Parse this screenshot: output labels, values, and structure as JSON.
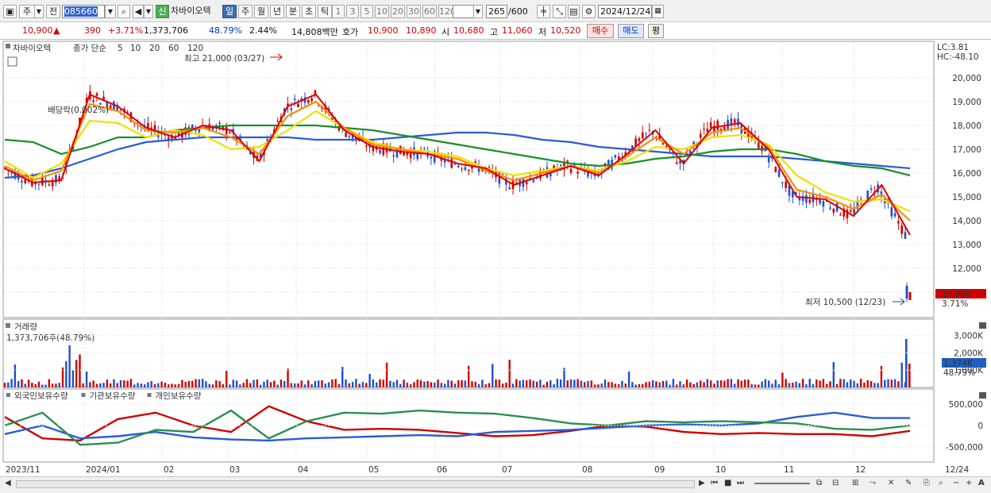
{
  "toolbar": {
    "period_label": "주",
    "name_mode": "전",
    "stock_code": "085660",
    "credit_badge": "신",
    "stock_name": "차바이오텍",
    "timeframes": [
      "일",
      "주",
      "월",
      "년",
      "분",
      "초",
      "틱"
    ],
    "active_timeframe": "일",
    "minute_options": [
      "1",
      "3",
      "5",
      "10",
      "20",
      "30",
      "60",
      "120"
    ],
    "count_value": "265",
    "count_max": "/600",
    "date_value": "2024/12/24"
  },
  "quote": {
    "price": "10,900",
    "change": "390",
    "change_pct": "+3.71%",
    "volume": "1,373,706",
    "volume_ratio": "48.79%",
    "turnover_ratio": "2.44%",
    "trade_value": "14,808백만",
    "bid_label": "호가",
    "bid": "10,900",
    "ask": "10,890",
    "open_label": "시",
    "open": "10,680",
    "high_label": "고",
    "high": "11,060",
    "low_label": "저",
    "low": "10,520",
    "buy_button": "매수",
    "sell_button": "매도",
    "eval_button": "평"
  },
  "price_panel": {
    "title": "차바이오텍",
    "ma_label": "종가 단순",
    "ma_periods": [
      "5",
      "10",
      "20",
      "60",
      "120"
    ],
    "ma_colors": [
      "#e00000",
      "#ff8c00",
      "#f0e000",
      "#1a8f2a",
      "#2a5bd7"
    ],
    "lc_label": "LC:3.81",
    "hc_label": "HC:-48.10",
    "max_annotation": "최고 21,000 (03/27)",
    "min_annotation": "최저 10,500 (12/23)",
    "dividend_annotation": "배당락(0.002%)",
    "current_price_tag": "10,900",
    "current_pct_tag": "3.71%",
    "y_ticks": [
      "20,000",
      "19,000",
      "18,000",
      "17,000",
      "16,000",
      "15,000",
      "14,000",
      "13,000",
      "12,000",
      "11,000"
    ]
  },
  "volume_panel": {
    "title": "거래량",
    "summary": "1,373,706주(48.79%)",
    "y_ticks": [
      "3,000K",
      "2,000K",
      "1,000K"
    ],
    "current_tag": "1,374K",
    "current_pct": "48.79%"
  },
  "holding_panel": {
    "series_labels": [
      "외국인보유수량",
      "기관보유수량",
      "개인보유수량"
    ],
    "series_colors": [
      "#d00000",
      "#2a5bd7",
      "#2a8f50"
    ],
    "y_ticks": [
      "500,000",
      "0",
      "-500,000"
    ]
  },
  "x_axis": {
    "labels": [
      "2023/11",
      "2024/01",
      "02",
      "03",
      "04",
      "05",
      "06",
      "07",
      "08",
      "09",
      "10",
      "11",
      "12",
      "12/24"
    ]
  },
  "chart_data": {
    "type": "line",
    "title": "차바이오텍",
    "y_range_price": [
      10500,
      21000
    ],
    "max_point": {
      "value": 21000,
      "date": "03/27"
    },
    "min_point": {
      "value": 10500,
      "date": "12/23"
    },
    "last_close": 10900,
    "series": [
      {
        "name": "5",
        "values": [
          16200,
          15600,
          15700,
          19300,
          18800,
          17900,
          17500,
          18000,
          17800,
          16500,
          18800,
          19300,
          17800,
          17100,
          16900,
          16800,
          16400,
          16200,
          15500,
          15900,
          16300,
          15900,
          16800,
          17800,
          16400,
          17900,
          18100,
          17000,
          15000,
          14900,
          14200,
          15500,
          13400
        ]
      },
      {
        "name": "10",
        "values": [
          16300,
          15700,
          16100,
          18900,
          18600,
          17800,
          17700,
          17900,
          17500,
          16800,
          18400,
          19000,
          17900,
          17200,
          17000,
          16800,
          16600,
          16100,
          15700,
          16000,
          16300,
          16000,
          16700,
          17500,
          16800,
          17700,
          17900,
          17100,
          15300,
          15000,
          14500,
          15100,
          14000
        ]
      },
      {
        "name": "20",
        "values": [
          16500,
          15800,
          16400,
          18200,
          18100,
          17500,
          17800,
          17600,
          17000,
          17100,
          17800,
          18600,
          17900,
          17300,
          17000,
          16900,
          16700,
          16200,
          15900,
          16100,
          16300,
          16100,
          16500,
          17100,
          17000,
          17500,
          17600,
          17200,
          15900,
          15200,
          14800,
          14900,
          14400
        ]
      },
      {
        "name": "60",
        "values": [
          17400,
          17300,
          16800,
          17100,
          17500,
          17500,
          17800,
          17900,
          18000,
          18000,
          18000,
          18000,
          17900,
          17800,
          17600,
          17400,
          17200,
          17000,
          16800,
          16600,
          16400,
          16300,
          16400,
          16600,
          16700,
          16900,
          17000,
          17000,
          16800,
          16500,
          16300,
          16200,
          15900
        ]
      },
      {
        "name": "120",
        "values": [
          15800,
          15900,
          16200,
          16600,
          17000,
          17300,
          17400,
          17500,
          17500,
          17500,
          17500,
          17400,
          17400,
          17400,
          17500,
          17600,
          17700,
          17700,
          17600,
          17400,
          17300,
          17100,
          17000,
          16900,
          16800,
          16700,
          16700,
          16700,
          16600,
          16500,
          16400,
          16300,
          16200
        ]
      }
    ]
  }
}
